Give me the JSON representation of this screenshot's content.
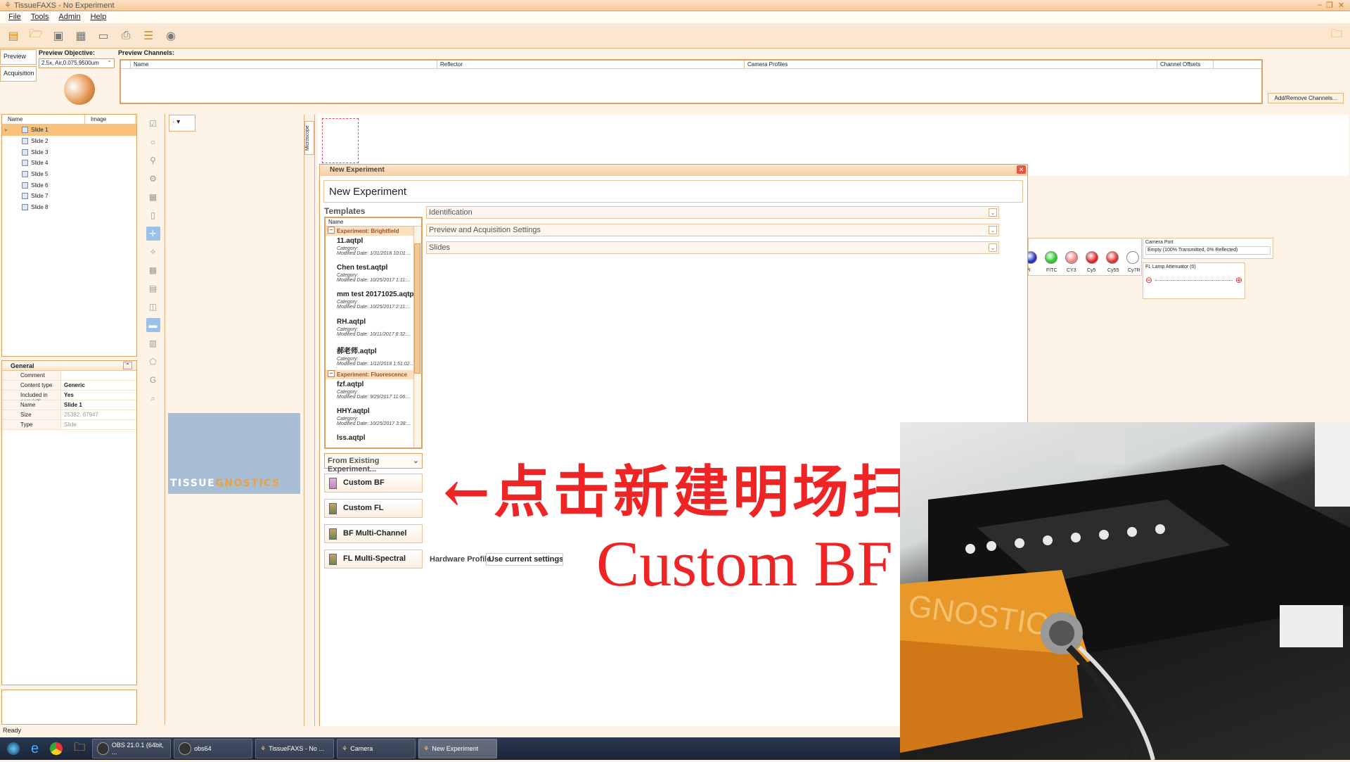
{
  "window": {
    "title": "TissueFAXS - No Experiment"
  },
  "menu": [
    "File",
    "Tools",
    "Admin",
    "Help"
  ],
  "side_tabs": [
    "Preview",
    "Acquisition"
  ],
  "preview": {
    "objective_label": "Preview Objective:",
    "objective_value": "2.5x, Air,0.075,9500um",
    "channels_label": "Preview Channels:",
    "channel_columns": [
      "Name",
      "Reflector",
      "Camera Profiles",
      "Channel Offsets"
    ],
    "add_remove_label": "Add/Remove Channels..."
  },
  "tree": {
    "columns": [
      "Name",
      "Image"
    ],
    "slides": [
      "Slide 1",
      "Slide 2",
      "Slide 3",
      "Slide 4",
      "Slide 5",
      "Slide 6",
      "Slide 7",
      "Slide 8"
    ]
  },
  "properties": {
    "section": "General",
    "rows": [
      {
        "k": "Comment",
        "v": ""
      },
      {
        "k": "Content type",
        "v": "Generic"
      },
      {
        "k": "Included in acquisiti",
        "v": "Yes"
      },
      {
        "k": "Name",
        "v": "Slide 1"
      },
      {
        "k": "Size",
        "v": "25382, 67947"
      },
      {
        "k": "Type",
        "v": "Slide"
      }
    ]
  },
  "microscope_tab": "Microscope",
  "logo": {
    "text_a": "TISSUE",
    "text_b": "GNOSTICS"
  },
  "filters": [
    {
      "label": "PI",
      "color": "#2030c0"
    },
    {
      "label": "FITC",
      "color": "#22cc22"
    },
    {
      "label": "CY3",
      "color": "#f08080"
    },
    {
      "label": "Cy5",
      "color": "#e02020"
    },
    {
      "label": "Cy55",
      "color": "#e03030"
    },
    {
      "label": "Cy7R",
      "color": "#ffffff"
    }
  ],
  "camera_port": {
    "label": "Camera Port",
    "value": "Empty (100% Transmitted, 0% Reflected)"
  },
  "lamp": {
    "label": "FL Lamp Attenuator (0)"
  },
  "dialog": {
    "title": "New Experiment",
    "name_value": "New Experiment",
    "templates_label": "Templates",
    "col_name": "Name",
    "groups": [
      {
        "name": "Experiment: Brightfield",
        "items": [
          {
            "name": "11.aqtpl",
            "category": "Category:",
            "date": "Modified Date: 1/31/2018 10:01:..."
          },
          {
            "name": "Chen test.aqtpl",
            "category": "Category:",
            "date": "Modified Date: 10/25/2017 1:11:..."
          },
          {
            "name": "mm test 20171025.aqtpl",
            "category": "Category:",
            "date": "Modified Date: 10/25/2017 2:11:..."
          },
          {
            "name": "RH.aqtpl",
            "category": "Category:",
            "date": "Modified Date: 10/11/2017 8:32:..."
          },
          {
            "name": "郝老师.aqtpl",
            "category": "Category:",
            "date": "Modified Date: 1/12/2018 1:51:02..."
          }
        ]
      },
      {
        "name": "Experiment: Fluorescence",
        "items": [
          {
            "name": "fzf.aqtpl",
            "category": "Category:",
            "date": "Modified Date: 9/29/2017 11:06:..."
          },
          {
            "name": "HHY.aqtpl",
            "category": "Category:",
            "date": "Modified Date: 10/25/2017 3:38:..."
          },
          {
            "name": "lss.aqtpl",
            "category": "",
            "date": ""
          }
        ]
      }
    ],
    "from_existing": "From Existing Experiment...",
    "buttons": [
      "Custom BF",
      "Custom FL",
      "BF Multi-Channel",
      "FL Multi-Spectral"
    ],
    "sections": [
      "Identification",
      "Preview and Acquisition Settings",
      "Slides"
    ],
    "hardware_label": "Hardware Profile",
    "hardware_value": "Use current settings"
  },
  "overlay": {
    "line1": "←点击新建明场扫描",
    "line2": "Custom BF"
  },
  "status": "Ready",
  "taskbar": [
    "OBS 21.0.1 (64bit, ...",
    "obs64",
    "TissueFAXS - No ...",
    "Camera",
    "New Experiment"
  ]
}
